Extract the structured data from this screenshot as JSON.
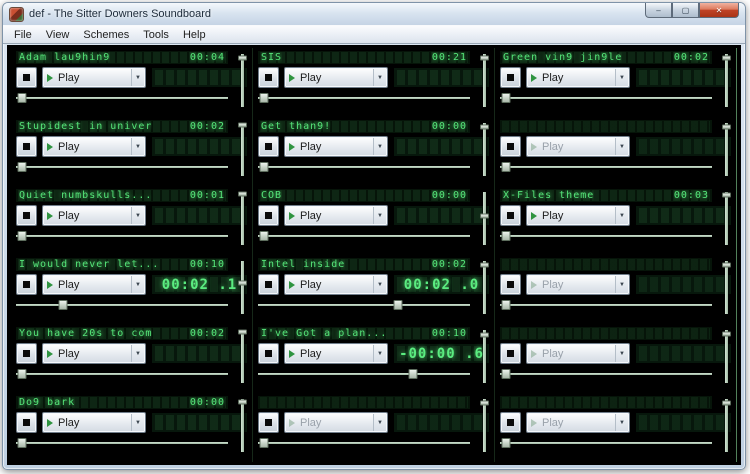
{
  "window": {
    "title": "def - The Sitter Downers Soundboard",
    "controls": {
      "minimize": "–",
      "maximize": "▢",
      "close": "✕"
    }
  },
  "menu": {
    "items": [
      "File",
      "View",
      "Schemes",
      "Tools",
      "Help"
    ]
  },
  "colors": {
    "led_green": "#55e378",
    "led_background": "#061409",
    "client_background": "#000000",
    "close_button_red": "#c04326",
    "slider_track": "#b7ccb9"
  },
  "board": {
    "play_label": "Play",
    "stop_icon": "stop-square",
    "cells": [
      {
        "occupied": true,
        "title": "Adam lau9hin9",
        "duration": "00:04",
        "time": "",
        "progress": 3,
        "volume": 8
      },
      {
        "occupied": true,
        "title": "SIS",
        "duration": "00:21",
        "time": "",
        "progress": 3,
        "volume": 8
      },
      {
        "occupied": true,
        "title": "Green vin9 jin9le",
        "duration": "00:02",
        "time": "",
        "progress": 3,
        "volume": 8
      },
      {
        "occupied": true,
        "title": "Stupidest in univer",
        "duration": "00:02",
        "time": "",
        "progress": 3,
        "volume": 4
      },
      {
        "occupied": true,
        "title": "Get than9!",
        "duration": "00:00",
        "time": "",
        "progress": 3,
        "volume": 8
      },
      {
        "occupied": false,
        "title": "",
        "duration": "",
        "time": "",
        "progress": 3,
        "volume": 8
      },
      {
        "occupied": true,
        "title": "Quiet numbskulls...",
        "duration": "00:01",
        "time": "",
        "progress": 3,
        "volume": 4
      },
      {
        "occupied": true,
        "title": "COB",
        "duration": "00:00",
        "time": "",
        "progress": 3,
        "volume": 45
      },
      {
        "occupied": true,
        "title": "X-Files theme",
        "duration": "00:03",
        "time": "",
        "progress": 3,
        "volume": 6
      },
      {
        "occupied": true,
        "title": "I would never let...",
        "duration": "00:10",
        "time": "00:02 .1",
        "progress": 22,
        "volume": 42
      },
      {
        "occupied": true,
        "title": "Intel inside",
        "duration": "00:02",
        "time": "00:02 .0",
        "progress": 66,
        "volume": 8
      },
      {
        "occupied": false,
        "title": "",
        "duration": "",
        "time": "",
        "progress": 3,
        "volume": 8
      },
      {
        "occupied": true,
        "title": "You have 20s to com",
        "duration": "00:02",
        "time": "",
        "progress": 3,
        "volume": 4
      },
      {
        "occupied": true,
        "title": "I've Got a plan...",
        "duration": "00:10",
        "time": "-00:00 .6",
        "progress": 73,
        "volume": 10
      },
      {
        "occupied": false,
        "title": "",
        "duration": "",
        "time": "",
        "progress": 3,
        "volume": 8
      },
      {
        "occupied": true,
        "title": "Do9 bark",
        "duration": "00:00",
        "time": "",
        "progress": 3,
        "volume": 6
      },
      {
        "occupied": false,
        "title": "",
        "duration": "",
        "time": "",
        "progress": 3,
        "volume": 8
      },
      {
        "occupied": false,
        "title": "",
        "duration": "",
        "time": "",
        "progress": 3,
        "volume": 8
      }
    ]
  }
}
